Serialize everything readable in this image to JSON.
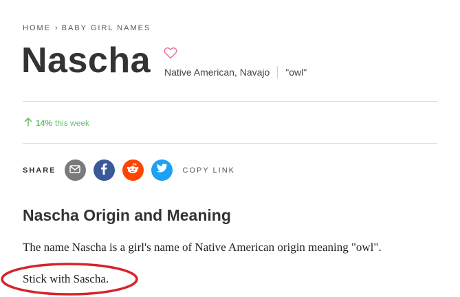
{
  "breadcrumb": {
    "home": "HOME",
    "separator": "›",
    "category": "BABY GIRL NAMES"
  },
  "name": {
    "title": "Nascha",
    "origin": "Native American, Navajo",
    "meaning": "\"owl\"",
    "favorite_icon": "heart-outline-icon"
  },
  "trend": {
    "icon": "arrow-up-icon",
    "percent": "14%",
    "label": "this week"
  },
  "share": {
    "label": "SHARE",
    "buttons": [
      {
        "name": "email",
        "icon": "envelope-icon",
        "color": "#7a7a7a"
      },
      {
        "name": "facebook",
        "icon": "facebook-icon",
        "color": "#3b5998"
      },
      {
        "name": "reddit",
        "icon": "reddit-icon",
        "color": "#ff4500"
      },
      {
        "name": "twitter",
        "icon": "twitter-icon",
        "color": "#1da1f2"
      }
    ],
    "copy_link": "COPY LINK"
  },
  "section": {
    "heading": "Nascha Origin and Meaning",
    "paragraphs": [
      "The name Nascha is a girl's name of Native American origin meaning \"owl\".",
      "Stick with Sascha."
    ]
  },
  "colors": {
    "trend_green": "#6fbf73",
    "heart_pink": "#e879a8",
    "annotation_red": "#d8232a"
  }
}
